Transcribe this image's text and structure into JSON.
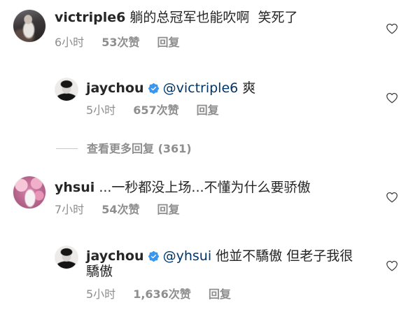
{
  "colors": {
    "text": "#262626",
    "meta": "#8e8e8e",
    "mention": "#003569",
    "verified": "#3897f0",
    "divider": "#c7c7c7"
  },
  "icons": {
    "like": "heart-outline-icon",
    "verified": "verified-badge-icon"
  },
  "comments": [
    {
      "username": "victriple6",
      "text": "躺的总冠军也能吹啊  笑死了",
      "time": "6小时",
      "likes": "53次赞",
      "reply_label": "回复",
      "replies": [
        {
          "username": "jaychou",
          "verified": true,
          "mention": "@victriple6",
          "text": "爽",
          "time": "5小时",
          "likes": "657次赞",
          "reply_label": "回复"
        }
      ],
      "view_more_replies": "查看更多回复 (361)"
    },
    {
      "username": "yhsui",
      "text": "...一秒都没上场...不懂为什么要骄傲",
      "time": "7小时",
      "likes": "54次赞",
      "reply_label": "回复",
      "replies": [
        {
          "username": "jaychou",
          "verified": true,
          "mention": "@yhsui",
          "text": "他並不驕傲 但老子我很驕傲",
          "time": "5小时",
          "likes": "1,636次赞",
          "reply_label": "回复"
        }
      ]
    }
  ]
}
